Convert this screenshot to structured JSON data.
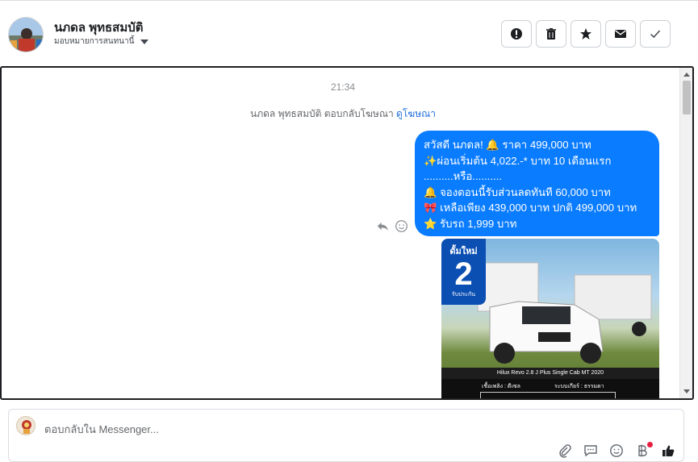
{
  "header": {
    "contact_name": "นภดล พุทธสมบัติ",
    "assign_label": "มอบหมายการสนทนานี้",
    "actions": [
      {
        "name": "report-icon"
      },
      {
        "name": "trash-icon"
      },
      {
        "name": "star-icon"
      },
      {
        "name": "envelope-icon"
      },
      {
        "name": "checkmark-icon"
      }
    ]
  },
  "thread": {
    "timestamp": "21:34",
    "reply_note": "นภดล พุทธสมบัติ ตอบกลับโฆษณา",
    "reply_link": "ดูโฆษณา",
    "message_lines": [
      "สวัสดี นภดล! 🔔  ราคา 499,000 บาท",
      "✨ผ่อนเริ่มต้น 4,022.-* บาท 10 เดือนแรก",
      "..........หรือ..........",
      "🔔 จองตอนนี้รับส่วนลดทันที 60,000 บาท",
      "🎀 เหลือเพียง 439,000 บาท ปกติ 499,000 บาท",
      "⭐ รับรถ 1,999 บาท"
    ],
    "photo": {
      "badge_top": "ดั้มใหม่",
      "badge_num": "2",
      "badge_sub": "รับประกัน",
      "caption": "Hilux Revo 2.8 J Plus Single Cab MT 2020",
      "fuel": "เชื้อเพลิง : ดีเซล",
      "gear": "ระบบเกียร์ : ธรรมดา"
    }
  },
  "composer": {
    "placeholder": "ตอบกลับใน Messenger..."
  },
  "colors": {
    "bubble": "#0a7cff",
    "link": "#216fdb"
  }
}
